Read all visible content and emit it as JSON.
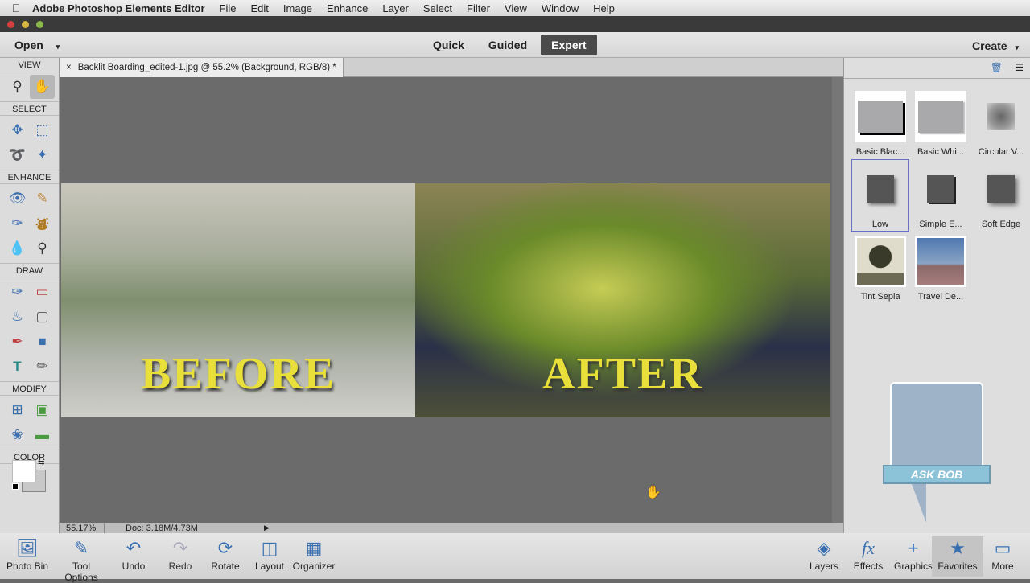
{
  "menubar": {
    "app": "Adobe Photoshop Elements Editor",
    "items": [
      "File",
      "Edit",
      "Image",
      "Enhance",
      "Layer",
      "Select",
      "Filter",
      "View",
      "Window",
      "Help"
    ]
  },
  "topbar": {
    "open": "Open",
    "modes": [
      "Quick",
      "Guided",
      "Expert"
    ],
    "active_mode": "Expert",
    "create": "Create"
  },
  "left": {
    "sections": [
      "VIEW",
      "SELECT",
      "ENHANCE",
      "DRAW",
      "MODIFY",
      "COLOR"
    ]
  },
  "document": {
    "tab": "Backlit Boarding_edited-1.jpg @ 55.2% (Background, RGB/8) *",
    "before_text": "BEFORE",
    "after_text": "AFTER"
  },
  "status": {
    "zoom": "55.17%",
    "doc": "Doc: 3.18M/4.73M"
  },
  "effects": {
    "items": [
      {
        "label": "Basic Blac..."
      },
      {
        "label": "Basic Whi..."
      },
      {
        "label": "Circular V..."
      },
      {
        "label": "Low"
      },
      {
        "label": "Simple E..."
      },
      {
        "label": "Soft Edge"
      },
      {
        "label": "Tint Sepia"
      },
      {
        "label": "Travel De..."
      }
    ],
    "selected": "Low"
  },
  "askbob": "ASK BOB",
  "bottom": {
    "left": [
      "Photo Bin",
      "Tool Options",
      "Undo",
      "Redo",
      "Rotate",
      "Layout",
      "Organizer"
    ],
    "right": [
      "Layers",
      "Effects",
      "Graphics",
      "Favorites",
      "More"
    ]
  },
  "colors": {
    "accent": "#3a6fb0",
    "selection": "#6670c8",
    "active_mode_bg": "#4a4a4a"
  }
}
